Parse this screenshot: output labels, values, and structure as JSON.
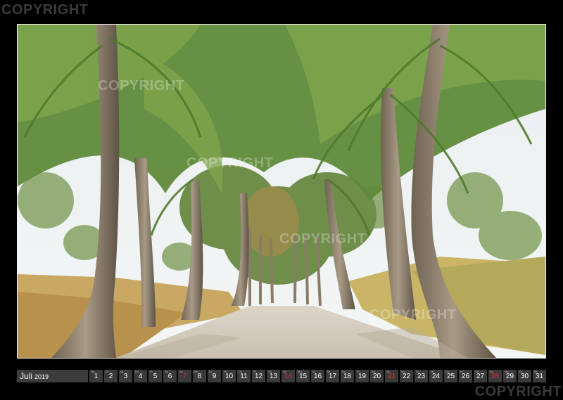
{
  "watermark": {
    "text": "COPYRIGHT"
  },
  "calendar": {
    "month": "Juli",
    "year": "2019",
    "sunday_color": "#e03030",
    "days": [
      {
        "wd": "Mo",
        "d": "1"
      },
      {
        "wd": "Di",
        "d": "2"
      },
      {
        "wd": "Mi",
        "d": "3"
      },
      {
        "wd": "Do",
        "d": "4"
      },
      {
        "wd": "Fr",
        "d": "5"
      },
      {
        "wd": "Sa",
        "d": "6"
      },
      {
        "wd": "So",
        "d": "7",
        "sun": true
      },
      {
        "wd": "Mo",
        "d": "8"
      },
      {
        "wd": "Di",
        "d": "9"
      },
      {
        "wd": "Mi",
        "d": "10"
      },
      {
        "wd": "Do",
        "d": "11"
      },
      {
        "wd": "Fr",
        "d": "12"
      },
      {
        "wd": "Sa",
        "d": "13"
      },
      {
        "wd": "So",
        "d": "14",
        "sun": true
      },
      {
        "wd": "Mo",
        "d": "15"
      },
      {
        "wd": "Di",
        "d": "16"
      },
      {
        "wd": "Mi",
        "d": "17"
      },
      {
        "wd": "Do",
        "d": "18"
      },
      {
        "wd": "Fr",
        "d": "19"
      },
      {
        "wd": "Sa",
        "d": "20"
      },
      {
        "wd": "So",
        "d": "21",
        "sun": true
      },
      {
        "wd": "Mo",
        "d": "22"
      },
      {
        "wd": "Di",
        "d": "23"
      },
      {
        "wd": "Mi",
        "d": "24"
      },
      {
        "wd": "Do",
        "d": "25"
      },
      {
        "wd": "Fr",
        "d": "26"
      },
      {
        "wd": "Sa",
        "d": "27"
      },
      {
        "wd": "So",
        "d": "28",
        "sun": true
      },
      {
        "wd": "Mo",
        "d": "29"
      },
      {
        "wd": "Di",
        "d": "30"
      },
      {
        "wd": "Mi",
        "d": "31"
      }
    ]
  }
}
